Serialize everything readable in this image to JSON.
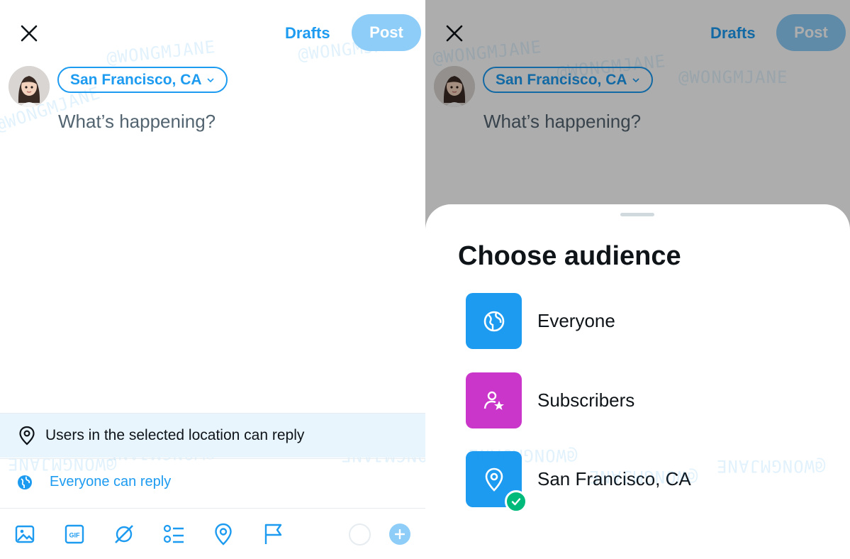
{
  "colors": {
    "accent": "#1d9bf0",
    "post_disabled": "#8ecdf8",
    "subscribers": "#c936c9",
    "check": "#00ba7c"
  },
  "compose": {
    "drafts_label": "Drafts",
    "post_label": "Post",
    "location_label": "San Francisco, CA",
    "placeholder": "What’s happening?",
    "reply_banner": "Users in the selected location can reply",
    "reply_setting": "Everyone can reply",
    "toolbar_icons": [
      "image-icon",
      "gif-icon",
      "grok-icon",
      "poll-icon",
      "location-icon",
      "flag-icon"
    ]
  },
  "audience_sheet": {
    "title": "Choose audience",
    "options": [
      {
        "label": "Everyone",
        "icon": "globe-icon",
        "selected": false
      },
      {
        "label": "Subscribers",
        "icon": "subscriber-star-icon",
        "selected": false
      },
      {
        "label": "San Francisco, CA",
        "icon": "location-pin-icon",
        "selected": true
      }
    ]
  },
  "watermark": "@WONGMJANE"
}
